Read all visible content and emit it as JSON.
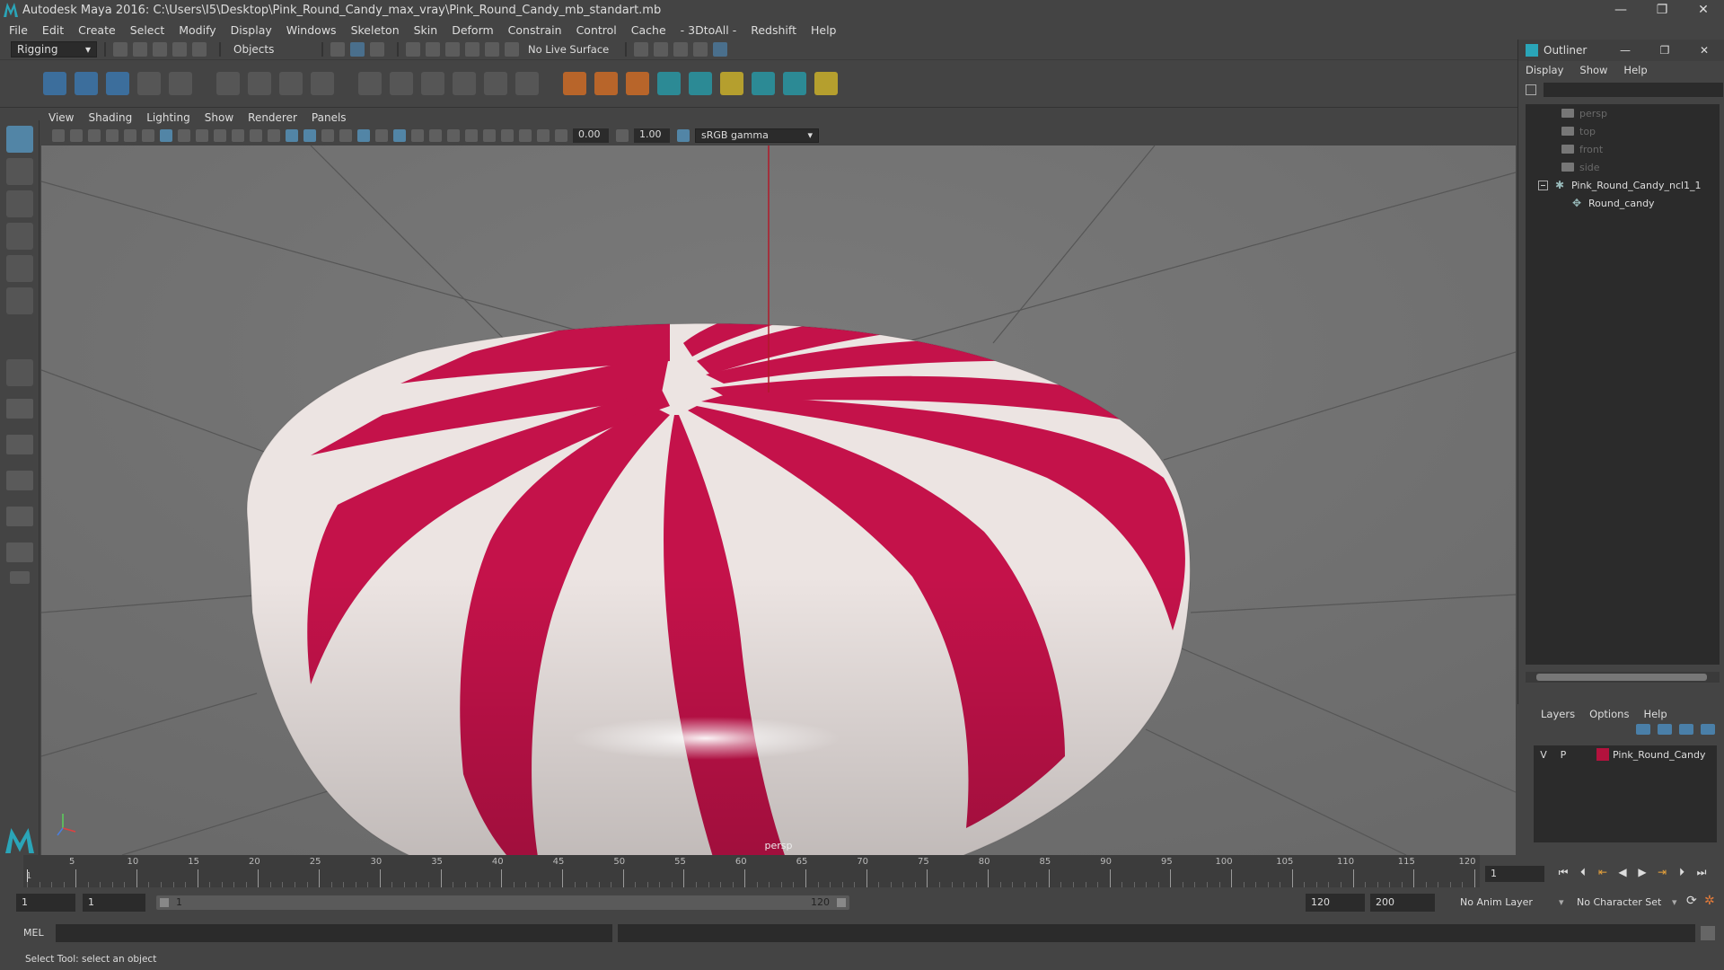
{
  "window": {
    "title": "Autodesk Maya 2016: C:\\Users\\I5\\Desktop\\Pink_Round_Candy_max_vray\\Pink_Round_Candy_mb_standart.mb",
    "minimize": "—",
    "restore": "❐",
    "close": "✕"
  },
  "menu": [
    "File",
    "Edit",
    "Create",
    "Select",
    "Modify",
    "Display",
    "Windows",
    "Skeleton",
    "Skin",
    "Deform",
    "Constrain",
    "Control",
    "Cache",
    "- 3DtoAll -",
    "Redshift",
    "Help"
  ],
  "statusline": {
    "mode": "Rigging",
    "selection_mode": "Objects",
    "live_surface": "No Live Surface"
  },
  "panel": {
    "menu": [
      "View",
      "Shading",
      "Lighting",
      "Show",
      "Renderer",
      "Panels"
    ],
    "exposure": "0.00",
    "gamma": "1.00",
    "color_space": "sRGB gamma",
    "camera_label": "persp"
  },
  "outliner": {
    "title": "Outliner",
    "menu": [
      "Display",
      "Show",
      "Help"
    ],
    "items": [
      {
        "label": "persp",
        "kind": "camera",
        "dim": true
      },
      {
        "label": "top",
        "kind": "camera",
        "dim": true
      },
      {
        "label": "front",
        "kind": "camera",
        "dim": true
      },
      {
        "label": "side",
        "kind": "camera",
        "dim": true
      },
      {
        "label": "Pink_Round_Candy_ncl1_1",
        "kind": "group",
        "dim": false
      },
      {
        "label": "Round_candy",
        "kind": "mesh",
        "dim": false
      }
    ]
  },
  "layers": {
    "menu": [
      "Layers",
      "Options",
      "Help"
    ],
    "rows": [
      {
        "v": "V",
        "p": "P",
        "name": "Pink_Round_Candy",
        "color": "#b3123d"
      }
    ]
  },
  "timeline": {
    "ticks": [
      5,
      10,
      15,
      20,
      25,
      30,
      35,
      40,
      45,
      50,
      55,
      60,
      65,
      70,
      75,
      80,
      85,
      90,
      95,
      100,
      105,
      110,
      115,
      120
    ],
    "start_label": "1",
    "current_frame": "1",
    "range_start": "1",
    "playback_start": "1",
    "slider_start": "1",
    "slider_end": "120",
    "playback_end": "120",
    "range_end": "200",
    "anim_layer": "No Anim Layer",
    "character_set": "No Character Set"
  },
  "command": {
    "language": "MEL",
    "help_text": "Select Tool: select an object"
  },
  "colors": {
    "candy_red": "#c4124a",
    "candy_white": "#ece4e2",
    "ui_bg": "#444444",
    "viewport_bg": "#727272",
    "accent": "#5285a6"
  }
}
